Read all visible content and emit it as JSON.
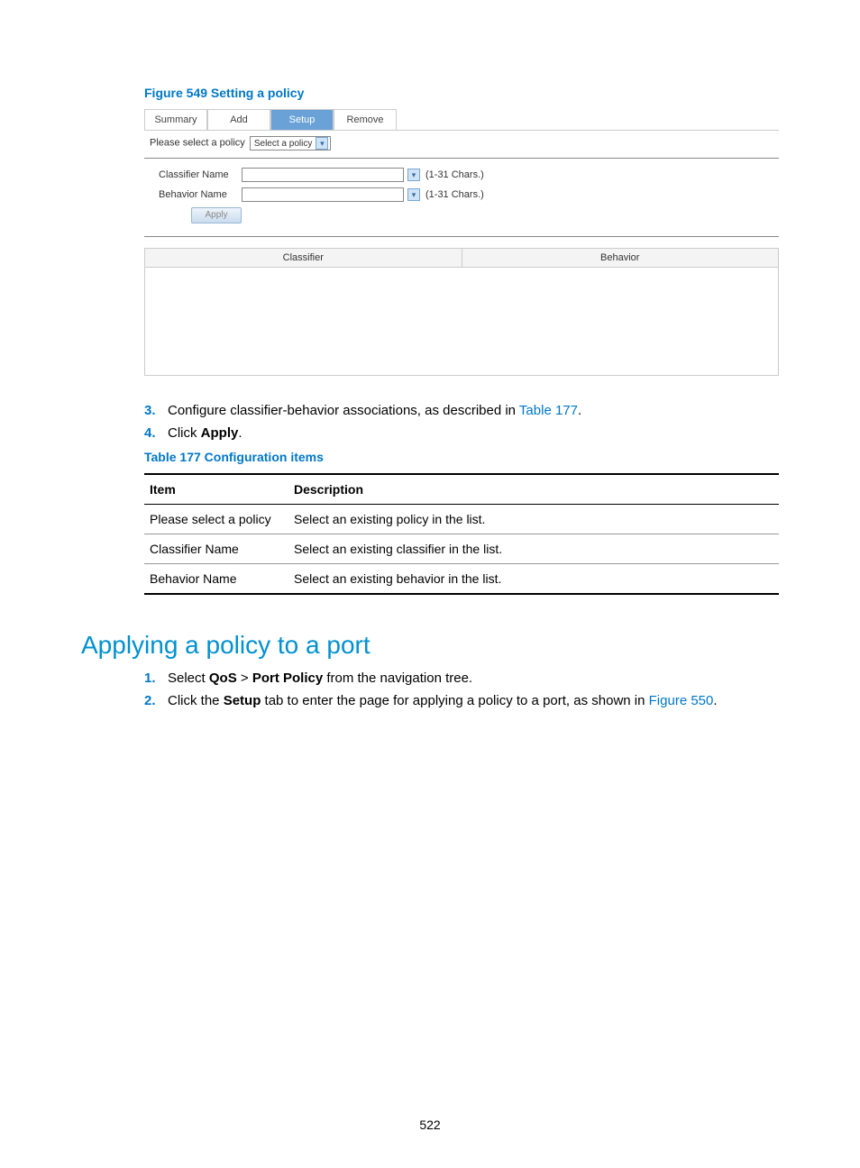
{
  "figure": {
    "caption": "Figure 549 Setting a policy",
    "tabs": [
      "Summary",
      "Add",
      "Setup",
      "Remove"
    ],
    "active_tab": "Setup",
    "policy_label": "Please select a policy",
    "policy_select": "Select a policy",
    "classifier_label": "Classifier Name",
    "behavior_label": "Behavior Name",
    "hint": "(1-31 Chars.)",
    "apply": "Apply",
    "grid_cols": [
      "Classifier",
      "Behavior"
    ]
  },
  "steps_a": [
    {
      "n": "3.",
      "pre": "Configure classifier-behavior associations, as described in ",
      "link": "Table 177",
      "post": "."
    },
    {
      "n": "4.",
      "pre": "Click ",
      "bold": "Apply",
      "post": "."
    }
  ],
  "table": {
    "caption": "Table 177 Configuration items",
    "head": [
      "Item",
      "Description"
    ],
    "rows": [
      [
        "Please select a policy",
        "Select an existing policy in the list."
      ],
      [
        "Classifier Name",
        "Select an existing classifier in the list."
      ],
      [
        "Behavior Name",
        "Select an existing behavior in the list."
      ]
    ]
  },
  "section_heading": "Applying a policy to a port",
  "steps_b": [
    {
      "n": "1.",
      "text_parts": [
        "Select ",
        {
          "b": "QoS"
        },
        " > ",
        {
          "b": "Port Policy"
        },
        " from the navigation tree."
      ]
    },
    {
      "n": "2.",
      "text_parts": [
        "Click the ",
        {
          "b": "Setup"
        },
        " tab to enter the page for applying a policy to a port, as shown in ",
        {
          "link": "Figure 550"
        },
        "."
      ]
    }
  ],
  "page_number": "522"
}
